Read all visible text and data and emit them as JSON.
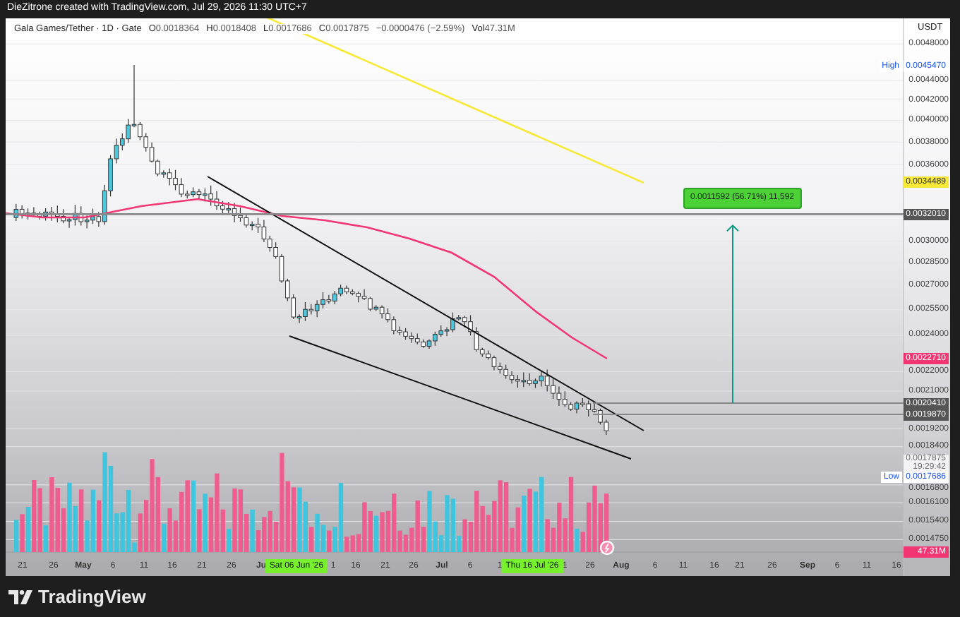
{
  "attribution": "DieZitrone created with TradingView.com, Jul 29, 2026 11:30 UTC+7",
  "legend": {
    "symbol": "Gala Games/Tether · 1D · Gate",
    "values": [
      {
        "label": "O",
        "value": "0.0018364"
      },
      {
        "label": "H",
        "value": "0.0018408"
      },
      {
        "label": "L",
        "value": "0.0017686"
      },
      {
        "label": "C",
        "value": "0.0017875"
      }
    ],
    "change": "−0.0000476 (−2.59%)",
    "volume_label": "Vol",
    "volume": "47.31M"
  },
  "measurement": {
    "text": "0.0011592 (56.71%) 11,592"
  },
  "price_axis": {
    "currency": "USDT",
    "ticks": [
      "0.0048000",
      "0.0044000",
      "0.0042000",
      "0.0040000",
      "0.0038000",
      "0.0036000",
      "0.0030000",
      "0.0028500",
      "0.0027000",
      "0.0025500",
      "0.0024000",
      "0.0022000",
      "0.0021000",
      "0.0019200",
      "0.0018400",
      "0.0016800",
      "0.0016100",
      "0.0015400",
      "0.0014750"
    ],
    "tags": [
      {
        "kind": "high",
        "label": "High",
        "value": "0.0045470",
        "color": "#1e53e5"
      },
      {
        "kind": "ma",
        "value": "0.0034489",
        "color": "#f7e936"
      },
      {
        "kind": "level",
        "value": "0.0032010",
        "color": "#555555"
      },
      {
        "kind": "ma",
        "value": "0.0022710",
        "color": "#f23674"
      },
      {
        "kind": "level",
        "value": "0.0020410",
        "color": "#555555"
      },
      {
        "kind": "level",
        "value": "0.0019870",
        "color": "#555555"
      },
      {
        "kind": "last",
        "value": "0.0017875",
        "time": "19:29:42",
        "color": "#6b6b6b"
      },
      {
        "kind": "low",
        "label": "Low",
        "value": "0.0017686",
        "color": "#1e53e5"
      },
      {
        "kind": "volume",
        "value": "47.31M",
        "color": "#f23674"
      }
    ]
  },
  "time_axis": {
    "ticks": [
      {
        "label": "21",
        "kind": "day"
      },
      {
        "label": "26",
        "kind": "day"
      },
      {
        "label": "May",
        "kind": "month"
      },
      {
        "label": "6",
        "kind": "day"
      },
      {
        "label": "11",
        "kind": "day"
      },
      {
        "label": "16",
        "kind": "day"
      },
      {
        "label": "21",
        "kind": "day"
      },
      {
        "label": "26",
        "kind": "day"
      },
      {
        "label": "Ju",
        "kind": "month"
      },
      {
        "label": "1",
        "kind": "day"
      },
      {
        "label": "16",
        "kind": "day"
      },
      {
        "label": "21",
        "kind": "day"
      },
      {
        "label": "26",
        "kind": "day"
      },
      {
        "label": "Jul",
        "kind": "month"
      },
      {
        "label": "6",
        "kind": "day"
      },
      {
        "label": "1",
        "kind": "day"
      },
      {
        "label": "1",
        "kind": "day"
      },
      {
        "label": "26",
        "kind": "day"
      },
      {
        "label": "Aug",
        "kind": "month"
      },
      {
        "label": "6",
        "kind": "day"
      },
      {
        "label": "11",
        "kind": "day"
      },
      {
        "label": "16",
        "kind": "day"
      },
      {
        "label": "21",
        "kind": "day"
      },
      {
        "label": "26",
        "kind": "day"
      },
      {
        "label": "Sep",
        "kind": "month"
      },
      {
        "label": "6",
        "kind": "day"
      },
      {
        "label": "11",
        "kind": "day"
      },
      {
        "label": "16",
        "kind": "day"
      }
    ],
    "highlights": [
      "Sat 06 Jun '26",
      "Thu 16 Jul '26"
    ]
  },
  "brand": "TradingView"
}
